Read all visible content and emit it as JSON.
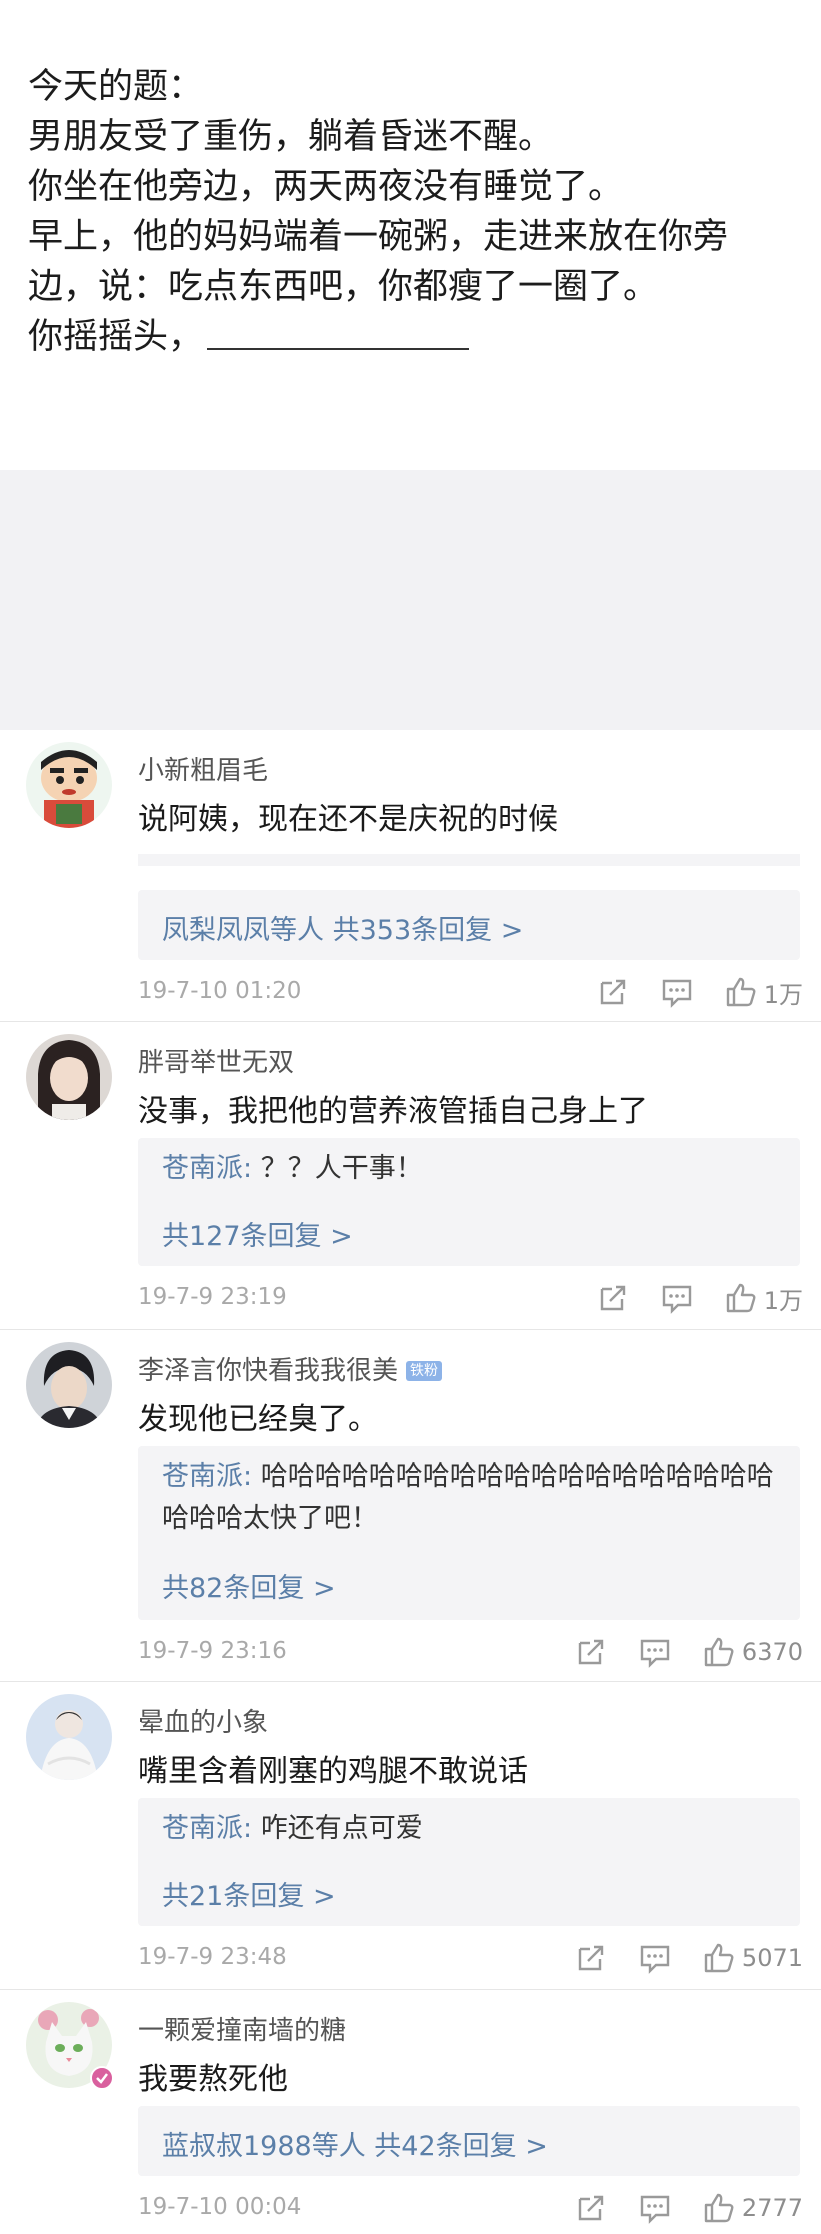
{
  "post": {
    "lines": [
      "今天的题：",
      "男朋友受了重伤，躺着昏迷不醒。",
      "你坐在他旁边，两天两夜没有睡觉了。",
      "早上，他的妈妈端着一碗粥，走进来放在你旁",
      "边，说：吃点东西吧，你都瘦了一圈了。",
      "你摇摇头，"
    ]
  },
  "comments": [
    {
      "username": "小新粗眉毛",
      "content": "说阿姨，现在还不是庆祝的时候",
      "reply_summary": "凤梨凤凤等人  共353条回复 >",
      "time": "19-7-10 01:20",
      "likes": "1万"
    },
    {
      "username": "胖哥举世无双",
      "content": "没事，我把他的营养液管插自己身上了",
      "reply_author": "苍南派:",
      "reply_text": " ？？人干事！",
      "reply_count": "共127条回复 >",
      "time": "19-7-9 23:19",
      "likes": "1万"
    },
    {
      "username": "李泽言你快看我我很美",
      "badge": "铁粉",
      "content": "发现他已经臭了。",
      "reply_author": "苍南派:",
      "reply_text": " 哈哈哈哈哈哈哈哈哈哈哈哈哈哈哈哈哈哈哈哈哈哈太快了吧！",
      "reply_count": "共82条回复 >",
      "time": "19-7-9 23:16",
      "likes": "6370"
    },
    {
      "username": "晕血的小象",
      "content": "嘴里含着刚塞的鸡腿不敢说话",
      "reply_author": "苍南派:",
      "reply_text": " 咋还有点可爱",
      "reply_count": "共21条回复 >",
      "time": "19-7-9 23:48",
      "likes": "5071"
    },
    {
      "username": "一颗爱撞南墙的糖",
      "content": "我要熬死他",
      "reply_summary": "蓝叔叔1988等人  共42条回复 >",
      "time": "19-7-10 00:04",
      "likes": "2777"
    }
  ],
  "colors": {
    "link_blue": "#5b7fa8",
    "gap_gray": "#f2f2f4",
    "reply_bg": "#f4f4f6",
    "badge_blue": "#8db3e8"
  },
  "icons": [
    "share-icon",
    "comment-icon",
    "thumbs-up-icon",
    "verified-icon"
  ]
}
